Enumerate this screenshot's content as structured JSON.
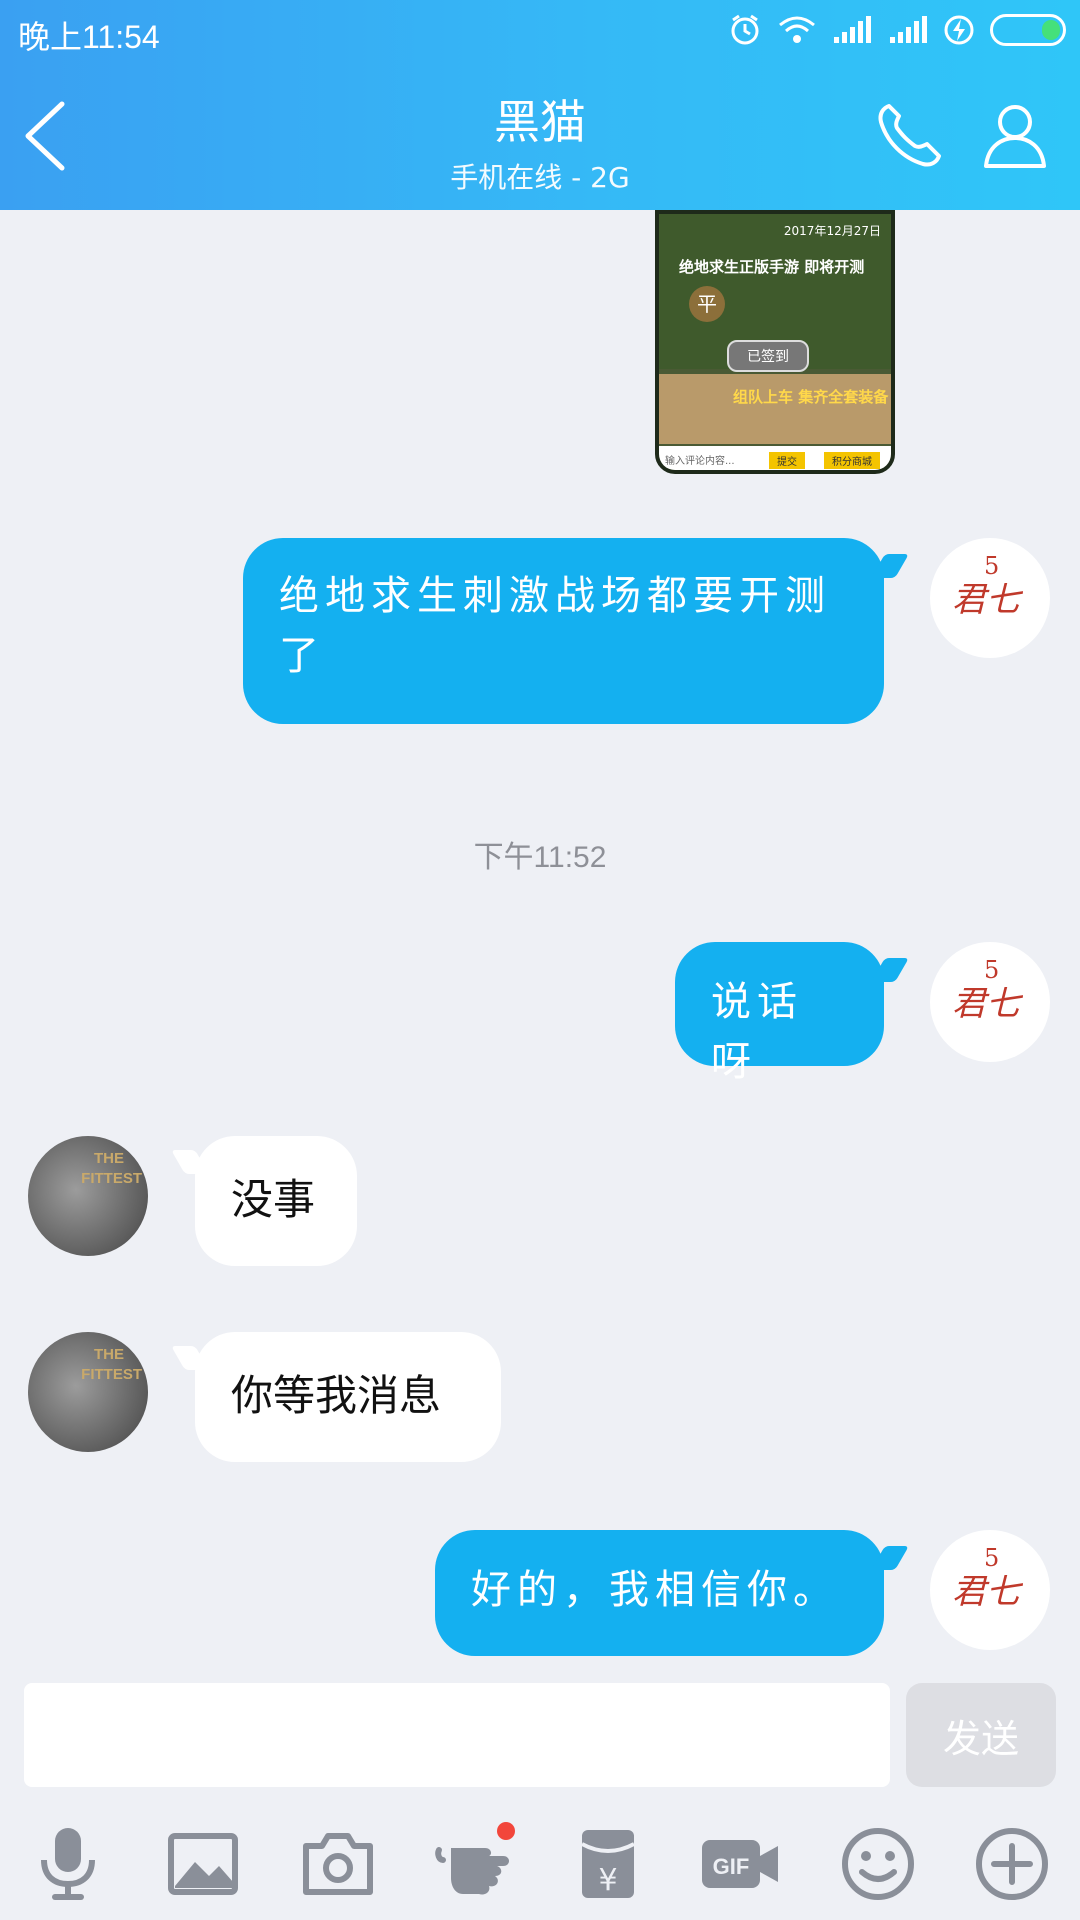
{
  "status_bar": {
    "time": "晚上11:54"
  },
  "header": {
    "title": "黑猫",
    "subtitle": "手机在线 - 2G"
  },
  "shared_image": {
    "date": "2017年12月27日",
    "headline": "绝地求生正版手游 即将开测",
    "emblem_char": "平",
    "signed_label": "已签到",
    "banner": "组队上车 集齐全套装备",
    "input_hint": "输入评论内容...",
    "submit_label": "提交",
    "mall_label": "积分商城"
  },
  "messages": [
    {
      "from": "self",
      "text": "绝地求生刺激战场都要开测了"
    },
    {
      "from": "self",
      "text": "说话呀"
    },
    {
      "from": "other",
      "text": "没事"
    },
    {
      "from": "other",
      "text": "你等我消息"
    },
    {
      "from": "self",
      "text": "好的，我相信你。"
    }
  ],
  "timestamp": "下午11:52",
  "avatars": {
    "self_glyph": "君七",
    "self_num": "5",
    "other_line1": "THE",
    "other_line2": "FITTEST"
  },
  "composer": {
    "placeholder": "",
    "send_label": "发送"
  },
  "toolbar_icons": [
    "microphone-icon",
    "image-icon",
    "camera-icon",
    "poke-hand-icon",
    "red-envelope-icon",
    "gif-icon",
    "emoji-icon",
    "plus-icon"
  ],
  "colors": {
    "header_start": "#3aa0f2",
    "header_end": "#2fc6f8",
    "bubble_out": "#14b0f0",
    "bubble_in": "#ffffff",
    "background": "#eef0f5",
    "toolbar_icon": "#8a8f99",
    "notification_dot": "#f2463b"
  }
}
